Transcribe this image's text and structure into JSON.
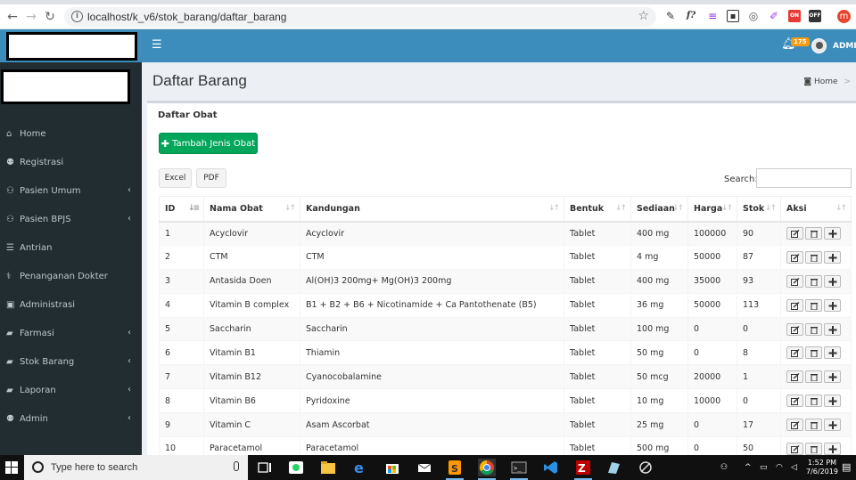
{
  "browser": {
    "url": "localhost/k_v6/stok_barang/daftar_barang",
    "ext_badge_1": "ON",
    "ext_badge_2": "OFF",
    "profile_initial": "m"
  },
  "header": {
    "notification_count": "175",
    "user_label": "ADMIN"
  },
  "sidebar": {
    "items": [
      {
        "label": "Home",
        "icon": "home-icon",
        "caret": false
      },
      {
        "label": "Registrasi",
        "icon": "user-plus-icon",
        "caret": false
      },
      {
        "label": "Pasien Umum",
        "icon": "users-icon",
        "caret": true
      },
      {
        "label": "Pasien BPJS",
        "icon": "users-icon",
        "caret": true
      },
      {
        "label": "Antrian",
        "icon": "list-icon",
        "caret": false
      },
      {
        "label": "Penanganan Dokter",
        "icon": "stethoscope-icon",
        "caret": false
      },
      {
        "label": "Administrasi",
        "icon": "money-icon",
        "caret": false
      },
      {
        "label": "Farmasi",
        "icon": "folder-icon",
        "caret": true
      },
      {
        "label": "Stok Barang",
        "icon": "folder-icon",
        "caret": true
      },
      {
        "label": "Laporan",
        "icon": "folder-icon",
        "caret": true
      },
      {
        "label": "Admin",
        "icon": "user-icon",
        "caret": true
      }
    ]
  },
  "page": {
    "title": "Daftar Barang",
    "breadcrumb_home": "Home",
    "box_title": "Daftar Obat",
    "add_button": "Tambah Jenis Obat",
    "export_excel": "Excel",
    "export_pdf": "PDF",
    "search_label": "Search:",
    "search_value": ""
  },
  "table": {
    "columns": [
      "ID",
      "Nama Obat",
      "Kandungan",
      "Bentuk",
      "Sediaan",
      "Harga",
      "Stok",
      "Aksi"
    ],
    "rows": [
      [
        "1",
        "Acyclovir",
        "Acyclovir",
        "Tablet",
        "400 mg",
        "100000",
        "90"
      ],
      [
        "2",
        "CTM",
        "CTM",
        "Tablet",
        "4 mg",
        "50000",
        "87"
      ],
      [
        "3",
        "Antasida Doen",
        "Al(OH)3 200mg+ Mg(OH)3 200mg",
        "Tablet",
        "400 mg",
        "35000",
        "93"
      ],
      [
        "4",
        "Vitamin B complex",
        "B1 + B2 + B6 + Nicotinamide + Ca Pantothenate (B5)",
        "Tablet",
        "36 mg",
        "50000",
        "113"
      ],
      [
        "5",
        "Saccharin",
        "Saccharin",
        "Tablet",
        "100 mg",
        "0",
        "0"
      ],
      [
        "6",
        "Vitamin B1",
        "Thiamin",
        "Tablet",
        "50 mg",
        "0",
        "8"
      ],
      [
        "7",
        "Vitamin B12",
        "Cyanocobalamine",
        "Tablet",
        "50 mcg",
        "20000",
        "1"
      ],
      [
        "8",
        "Vitamin B6",
        "Pyridoxine",
        "Tablet",
        "10 mg",
        "10000",
        "0"
      ],
      [
        "9",
        "Vitamin C",
        "Asam Ascorbat",
        "Tablet",
        "25 mg",
        "0",
        "17"
      ],
      [
        "10",
        "Paracetamol",
        "Paracetamol",
        "Tablet",
        "500 mg",
        "0",
        "50"
      ]
    ]
  },
  "taskbar": {
    "search_placeholder": "Type here to search",
    "time": "1:52 PM",
    "date": "7/6/2019"
  },
  "colors": {
    "header": "#3c8dbc",
    "sidebar": "#222d32",
    "add_button": "#00a65a",
    "badge": "#f39c12"
  }
}
